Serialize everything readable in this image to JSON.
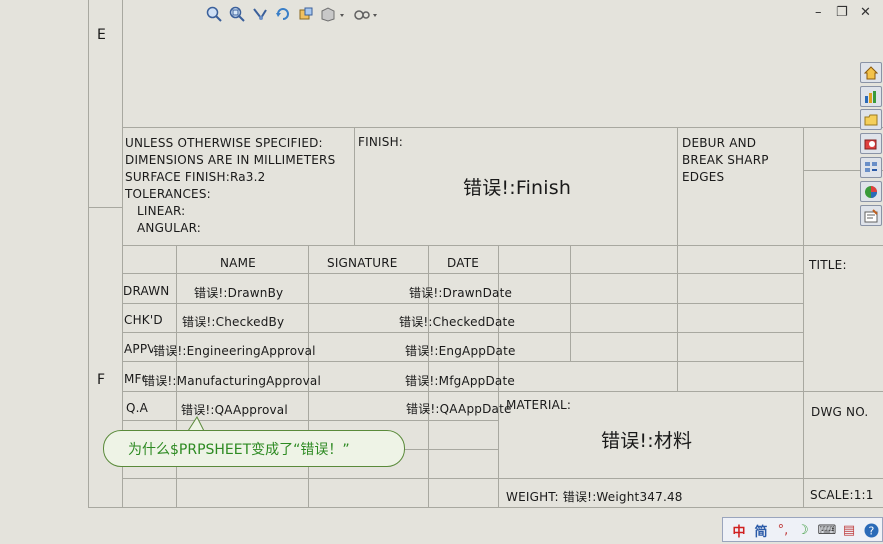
{
  "toolbar": {
    "icons": [
      "zoom-fit-icon",
      "zoom-area-icon",
      "pan-icon",
      "rotate-icon",
      "view-orientation-icon",
      "display-style-icon",
      "hide-show-icon"
    ]
  },
  "window_controls": {
    "minimize": "–",
    "restore": "❐",
    "close": "✕"
  },
  "zones": {
    "e": "E",
    "f": "F"
  },
  "notes": {
    "line1": "UNLESS OTHERWISE SPECIFIED:",
    "line2": "DIMENSIONS ARE IN MILLIMETERS",
    "line3": "SURFACE FINISH:Ra3.2",
    "line4": "TOLERANCES:",
    "line5": "LINEAR:",
    "line6": "ANGULAR:"
  },
  "finish": {
    "label": "FINISH:",
    "value": "错误!:Finish"
  },
  "deburr": {
    "line1": "DEBUR AND",
    "line2": "BREAK SHARP",
    "line3": "EDGES"
  },
  "table": {
    "headers": {
      "name": "NAME",
      "signature": "SIGNATURE",
      "date": "DATE"
    },
    "rows": [
      {
        "role": "DRAWN",
        "name": "错误!:DrawnBy",
        "date": "错误!:DrawnDate"
      },
      {
        "role": "CHK'D",
        "name": "错误!:CheckedBy",
        "date": "错误!:CheckedDate"
      },
      {
        "role": "APPV'D",
        "name": "错误!:EngineeringApproval",
        "date": "错误!:EngAppDate"
      },
      {
        "role": "MFG",
        "name": "错误!:ManufacturingApproval",
        "date": "错误!:MfgAppDate"
      },
      {
        "role": "Q.A",
        "name": "错误!:QAApproval",
        "date": "错误!:QAAppDate"
      }
    ]
  },
  "title_label": "TITLE:",
  "material": {
    "label": "MATERIAL:",
    "value": "错误!:材料"
  },
  "dwg_no": "DWG NO.",
  "weight": "WEIGHT: 错误!:Weight347.48",
  "scale": "SCALE:1:1",
  "callout": "为什么$PRPSHEET变成了“错误！”",
  "side_panel": {
    "icons": [
      "home-icon",
      "design-library-icon",
      "file-explorer-icon",
      "search-icon",
      "view-palette-icon",
      "appearances-icon",
      "custom-properties-icon"
    ]
  },
  "tray": {
    "icons": [
      "chinese-input-icon",
      "full-width-icon",
      "punctuation-icon",
      "moon-icon",
      "keyboard-icon",
      "menu-icon",
      "help-icon"
    ]
  },
  "colors": {
    "background": "#e4e3dc",
    "lines": "#a8a8a0",
    "callout_text": "#2d8a22"
  }
}
